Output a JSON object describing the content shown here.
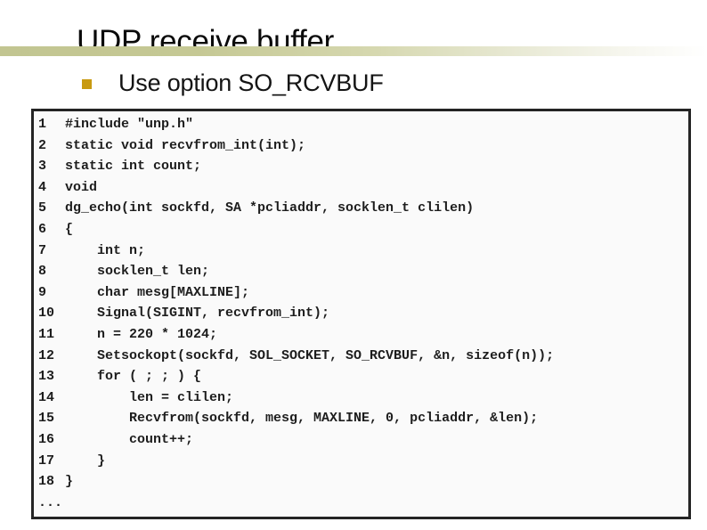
{
  "slide": {
    "title": "UDP receive buffer",
    "accent_color": "#c89a11",
    "rule_color_left": "#c2c591",
    "rule_color_right": "#ffffff",
    "background": "#ffffff"
  },
  "bullet": {
    "marker": "square-bullet-icon",
    "text": "Use option SO_RCVBUF"
  },
  "code_block": {
    "border_color": "#242424",
    "background": "#fafafa",
    "lines": [
      {
        "no": "1",
        "code": "#include \"unp.h\""
      },
      {
        "no": "2",
        "code": "static void recvfrom_int(int);"
      },
      {
        "no": "3",
        "code": "static int count;"
      },
      {
        "no": "4",
        "code": "void"
      },
      {
        "no": "5",
        "code": "dg_echo(int sockfd, SA *pcliaddr, socklen_t clilen)"
      },
      {
        "no": "6",
        "code": "{"
      },
      {
        "no": "7",
        "code": "    int n;"
      },
      {
        "no": "8",
        "code": "    socklen_t len;"
      },
      {
        "no": "9",
        "code": "    char mesg[MAXLINE];"
      },
      {
        "no": "10",
        "code": "    Signal(SIGINT, recvfrom_int);"
      },
      {
        "no": "11",
        "code": "    n = 220 * 1024;"
      },
      {
        "no": "12",
        "code": "    Setsockopt(sockfd, SOL_SOCKET, SO_RCVBUF, &n, sizeof(n));"
      },
      {
        "no": "13",
        "code": "    for ( ; ; ) {"
      },
      {
        "no": "14",
        "code": "        len = clilen;"
      },
      {
        "no": "15",
        "code": "        Recvfrom(sockfd, mesg, MAXLINE, 0, pcliaddr, &len);"
      },
      {
        "no": "16",
        "code": "        count++;"
      },
      {
        "no": "17",
        "code": "    }"
      },
      {
        "no": "18",
        "code": "}"
      },
      {
        "no": "...",
        "code": ""
      }
    ]
  }
}
